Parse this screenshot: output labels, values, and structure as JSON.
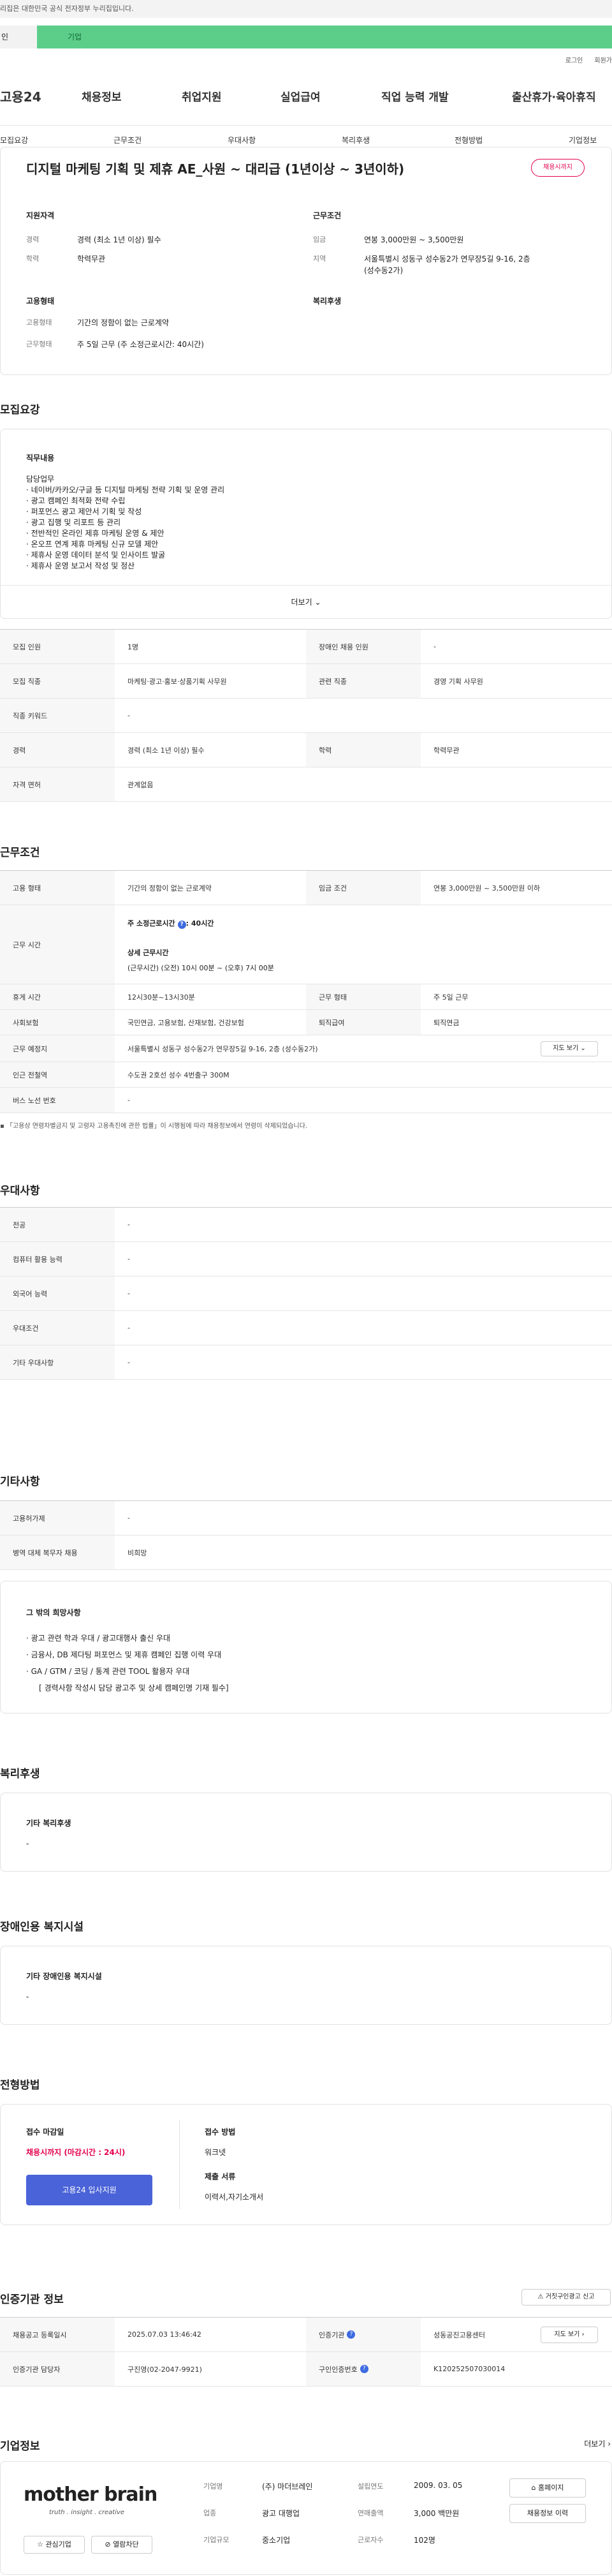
{
  "gov_banner": "리집은 대한민국 공식 전자정부 누리집입니다.",
  "tabs": [
    "인",
    "기업"
  ],
  "util": [
    "로그인",
    "회원가"
  ],
  "logo": "고용24",
  "gnb": [
    "채용정보",
    "취업지원",
    "실업급여",
    "직업 능력 개발",
    "출산휴가·육아휴직"
  ],
  "snb": [
    "모집요강",
    "근무조건",
    "우대사항",
    "복리후생",
    "전형방법",
    "기업정보"
  ],
  "job": {
    "title": "디지털 마케팅 기획 및 제휴 AE_사원 ~ 대리급 (1년이상 ~ 3년이하)",
    "badge": "채용시까지",
    "qual_title": "지원자격",
    "career_l": "경력",
    "career_v": "경력 (최소 1년 이상) 필수",
    "edu_l": "학력",
    "edu_v": "학력무관",
    "cond_title": "근무조건",
    "wage_l": "임금",
    "wage_v": "연봉 3,000만원 ~ 3,500만원",
    "loc_l": "지역",
    "loc_v1": "서울특별시 성동구 성수동2가 연무장5길 9-16, 2층",
    "loc_v2": "(성수동2가)",
    "emp_title": "고용형태",
    "emp_l": "고용형태",
    "emp_v": "기간의 정함이 없는 근로계약",
    "hours_l": "근무형태",
    "hours_v": "주 5일 근무 (주 소정근로시간: 40시간)",
    "welfare_title": "복리후생"
  },
  "recruit": {
    "title": "모집요강",
    "duty_title": "직무내용",
    "duty": [
      "담당업무",
      "· 네이버/카카오/구글 등 디지털 마케팅 전략 기획 및 운영 관리",
      "· 광고 캠페인 최적화 전략 수립",
      "· 퍼포먼스 광고 제안서 기획 및 작성",
      "· 광고 집행 및 리포트 등 관리",
      "· 전반적인 온라인 제휴 마케팅 운영 & 제안",
      "· 온오프 연계 제휴 마케팅 신규 모델 제안",
      "· 제휴사 운영 데이터 분석 및 인사이트 발굴",
      "· 제휴사 운영 보고서 작성 및 정산"
    ],
    "more": "더보기",
    "rows": [
      [
        "모집 인원",
        "1명",
        "장애인 채용 인원",
        "-"
      ],
      [
        "모집 직종",
        "마케팅·광고·홍보·상품기획 사무원",
        "관련 직종",
        "경영 기획 사무원"
      ],
      [
        "직종 키워드",
        "-"
      ],
      [
        "경력",
        "경력 (최소 1년 이상) 필수",
        "학력",
        "학력무관"
      ],
      [
        "자격 면허",
        "관계없음"
      ]
    ]
  },
  "work": {
    "title": "근무조건",
    "emp_l": "고용 형태",
    "emp_v": "기간의 정함이 없는 근로계약",
    "wage_l": "임금 조건",
    "wage_v": "연봉 3,000만원 ~ 3,500만원 이하",
    "time_l": "근무 시간",
    "time_v1": "주 소정근로시간",
    "time_v1b": ": 40시간",
    "time_v2": "상세 근무시간",
    "time_v3": "(근무시간) (오전) 10시 00분 ~ (오후) 7시 00분",
    "rest_l": "휴게 시간",
    "rest_v": "12시30분~13시30분",
    "type_l": "근무 형태",
    "type_v": "주 5일 근무",
    "ins_l": "사회보험",
    "ins_v": "국민연금, 고용보험, 산재보험, 건강보험",
    "ret_l": "퇴직급여",
    "ret_v": "퇴직연금",
    "addr_l": "근무 예정지",
    "addr_v": "서울특별시 성동구 성수동2가 연무장5길 9-16, 2층 (성수동2가)",
    "map": "지도 보기",
    "sub_l": "인근 전철역",
    "sub_v": "수도권 2호선 성수 4번출구 300M",
    "bus_l": "버스 노선 번호",
    "bus_v": "-",
    "note": "「고용상 연령차별금지 및 고령자 고용촉진에 관한 법률」이 시행됨에 따라 채용정보에서 연령이 삭제되었습니다."
  },
  "pref": {
    "title": "우대사항",
    "rows": [
      [
        "전공",
        "-"
      ],
      [
        "컴퓨터 활용 능력",
        "-"
      ],
      [
        "외국어 능력",
        "-"
      ],
      [
        "우대조건",
        "-"
      ],
      [
        "기타 우대사항",
        "-"
      ]
    ]
  },
  "etc": {
    "title": "기타사항",
    "rows": [
      [
        "고용허가제",
        "-"
      ],
      [
        "병역 대체 복무자 채용",
        "비희망"
      ]
    ],
    "box_title": "그 밖의 희망사항",
    "box": [
      "· 광고 관련 학과 우대 / 광고대행사 출신 우대",
      "· 금융사, DB 제다팅 퍼포먼스 및 제휴 캠페인 집행 이력 우대",
      "· GA / GTM / 코딩 / 통계 관련 TOOL 활용자 우대",
      "[ 경력사항 작성시 담당 광고주 및 상세 캠페인명 기재 필수]"
    ]
  },
  "welfare": {
    "title": "복리후생",
    "box_title": "기타 복리후생",
    "box_v": "-"
  },
  "disab": {
    "title": "장애인용 복지시설",
    "box_title": "기타 장애인용 복지시설",
    "box_v": "-"
  },
  "apply": {
    "title": "전형방법",
    "deadline_l": "접수 마감일",
    "deadline_v": "채용시까지 (마감시간 : 24시)",
    "apply_btn": "고용24 입사지원",
    "method_l": "접수 방법",
    "method_v": "워크넷",
    "docs_l": "제출 서류",
    "docs_v": "이력서,자기소개서"
  },
  "cert": {
    "title": "인증기관 정보",
    "report": "거짓구인광고 신고",
    "rows": [
      [
        "채용공고 등록일시",
        "2025.07.03 13:46:42",
        "인증기관",
        "성동공진고용센터"
      ],
      [
        "인증기관 담당자",
        "구진영(02-2047-9921)",
        "구인인증번호",
        "K120252507030014"
      ]
    ],
    "map": "지도 보기"
  },
  "company": {
    "title": "기업정보",
    "more": "더보기",
    "logo": "mother brain",
    "tagline": "truth . insight . creative",
    "fav": "관심기업",
    "block": "열람차단",
    "name_l": "기업명",
    "name_v": "(주) 마더브레인",
    "year_l": "설립연도",
    "year_v": "2009. 03. 05",
    "biz_l": "업종",
    "biz_v": "광고 대행업",
    "sales_l": "연매출액",
    "sales_v": "3,000 백만원",
    "size_l": "기업규모",
    "size_v": "중소기업",
    "emp_l": "근로자수",
    "emp_v": "102명",
    "home": "홈페이지",
    "jobs": "채용정보 이력"
  }
}
